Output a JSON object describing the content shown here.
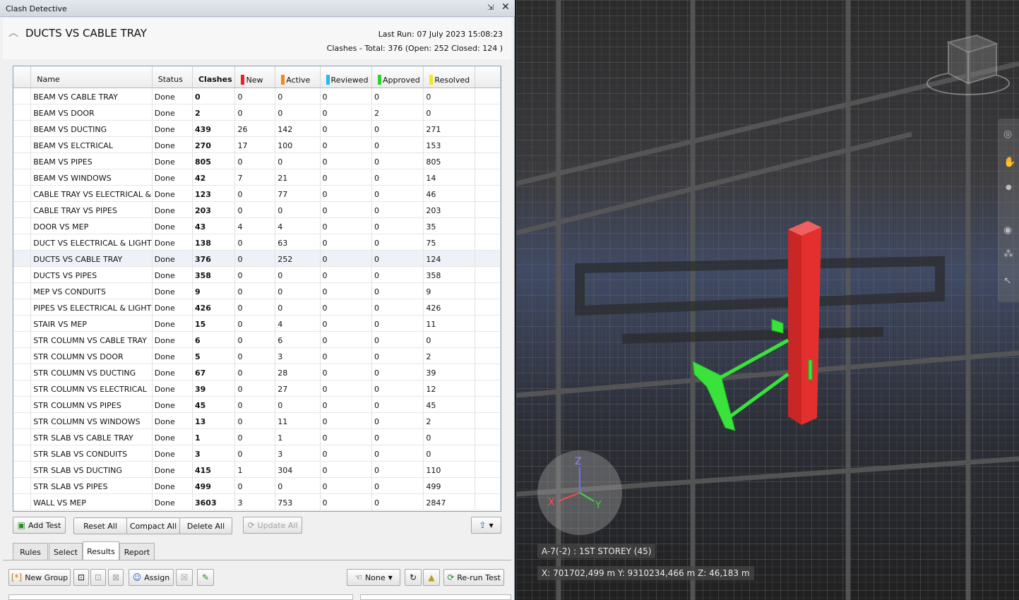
{
  "window": {
    "title": "Clash Detective"
  },
  "header": {
    "test_name": "DUCTS VS CABLE TRAY",
    "last_run": "Last Run:  07 July 2023 15:08:23",
    "summary": "Clashes -  Total:  376  (Open:  252  Closed:  124 )"
  },
  "grid": {
    "columns": [
      {
        "label": "Name",
        "color": ""
      },
      {
        "label": "Status",
        "color": ""
      },
      {
        "label": "Clashes",
        "color": ""
      },
      {
        "label": "New",
        "color": "#e8202a"
      },
      {
        "label": "Active",
        "color": "#f08a1c"
      },
      {
        "label": "Reviewed",
        "color": "#26b8e8"
      },
      {
        "label": "Approved",
        "color": "#2ad62a"
      },
      {
        "label": "Resolved",
        "color": "#f2e81e"
      }
    ],
    "rows": [
      [
        "BEAM VS CABLE TRAY",
        "Done",
        "0",
        "0",
        "0",
        "0",
        "0",
        "0"
      ],
      [
        "BEAM VS DOOR",
        "Done",
        "2",
        "0",
        "0",
        "0",
        "2",
        "0"
      ],
      [
        "BEAM VS DUCTING",
        "Done",
        "439",
        "26",
        "142",
        "0",
        "0",
        "271"
      ],
      [
        "BEAM VS ELCTRICAL",
        "Done",
        "270",
        "17",
        "100",
        "0",
        "0",
        "153"
      ],
      [
        "BEAM VS PIPES",
        "Done",
        "805",
        "0",
        "0",
        "0",
        "0",
        "805"
      ],
      [
        "BEAM VS WINDOWS",
        "Done",
        "42",
        "7",
        "21",
        "0",
        "0",
        "14"
      ],
      [
        "CABLE TRAY VS ELECTRICAL &",
        "Done",
        "123",
        "0",
        "77",
        "0",
        "0",
        "46"
      ],
      [
        "CABLE TRAY VS PIPES",
        "Done",
        "203",
        "0",
        "0",
        "0",
        "0",
        "203"
      ],
      [
        "DOOR VS MEP",
        "Done",
        "43",
        "4",
        "4",
        "0",
        "0",
        "35"
      ],
      [
        "DUCT VS ELECTRICAL & LIGHT",
        "Done",
        "138",
        "0",
        "63",
        "0",
        "0",
        "75"
      ],
      [
        "DUCTS VS CABLE TRAY",
        "Done",
        "376",
        "0",
        "252",
        "0",
        "0",
        "124"
      ],
      [
        "DUCTS VS PIPES",
        "Done",
        "358",
        "0",
        "0",
        "0",
        "0",
        "358"
      ],
      [
        "MEP VS CONDUITS",
        "Done",
        "9",
        "0",
        "0",
        "0",
        "0",
        "9"
      ],
      [
        "PIPES VS ELECTRICAL & LIGHT",
        "Done",
        "426",
        "0",
        "0",
        "0",
        "0",
        "426"
      ],
      [
        "STAIR VS MEP",
        "Done",
        "15",
        "0",
        "4",
        "0",
        "0",
        "11"
      ],
      [
        "STR COLUMN VS CABLE TRAY",
        "Done",
        "6",
        "0",
        "6",
        "0",
        "0",
        "0"
      ],
      [
        "STR COLUMN VS DOOR",
        "Done",
        "5",
        "0",
        "3",
        "0",
        "0",
        "2"
      ],
      [
        "STR COLUMN VS DUCTING",
        "Done",
        "67",
        "0",
        "28",
        "0",
        "0",
        "39"
      ],
      [
        "STR COLUMN VS ELECTRICAL",
        "Done",
        "39",
        "0",
        "27",
        "0",
        "0",
        "12"
      ],
      [
        "STR COLUMN VS PIPES",
        "Done",
        "45",
        "0",
        "0",
        "0",
        "0",
        "45"
      ],
      [
        "STR COLUMN VS WINDOWS",
        "Done",
        "13",
        "0",
        "11",
        "0",
        "0",
        "2"
      ],
      [
        "STR SLAB VS CABLE TRAY",
        "Done",
        "1",
        "0",
        "1",
        "0",
        "0",
        "0"
      ],
      [
        "STR SLAB VS CONDUITS",
        "Done",
        "3",
        "0",
        "3",
        "0",
        "0",
        "0"
      ],
      [
        "STR SLAB VS DUCTING",
        "Done",
        "415",
        "1",
        "304",
        "0",
        "0",
        "110"
      ],
      [
        "STR SLAB VS PIPES",
        "Done",
        "499",
        "0",
        "0",
        "0",
        "0",
        "499"
      ],
      [
        "WALL VS MEP",
        "Done",
        "3603",
        "3",
        "753",
        "0",
        "0",
        "2847"
      ]
    ]
  },
  "toolbar": {
    "add_test": "Add Test",
    "reset_all": "Reset All",
    "compact_all": "Compact All",
    "delete_all": "Delete All",
    "update_all": "Update All"
  },
  "tabs": [
    "Rules",
    "Select",
    "Results",
    "Report"
  ],
  "results_toolbar": {
    "new_group": "New Group",
    "assign": "Assign",
    "none": "None",
    "rerun_test": "Re-run Test"
  },
  "viewport": {
    "level_label": "A-7(-2) : 1ST STOREY (45)",
    "coords_label": "X: 701702,499 m  Y: 9310234,466 m  Z: 46,183 m",
    "axis_x": "X",
    "axis_y": "Y",
    "axis_z": "Z",
    "clash_colors": {
      "element_a": "#e3302f",
      "element_b": "#39e33b"
    }
  }
}
